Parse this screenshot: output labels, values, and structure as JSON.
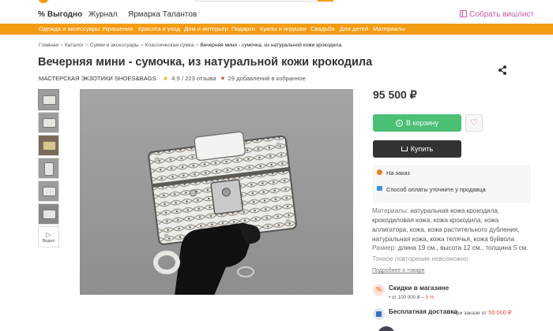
{
  "header": {
    "nav": [
      {
        "label": "Выгодно",
        "prefix": "%"
      },
      {
        "label": "Журнал"
      },
      {
        "label": "Ярмарка Талантов"
      }
    ],
    "wishlist_label": "Собрать вишлист"
  },
  "categories": [
    "Одежда и аксессуары",
    "Украшения",
    "Красота и уход",
    "Дом и интерьер",
    "Подарки",
    "Куклы и игрушки",
    "Свадьба",
    "Для детей",
    "Материалы"
  ],
  "breadcrumb": {
    "items": [
      "Главная",
      "Каталог",
      "Сумки и аксессуары",
      "Классическая сумка"
    ],
    "current": "Вечерняя мини - сумочка, из натуральной кожи крокодила."
  },
  "product": {
    "title": "Вечерняя мини - сумочка, из натуральной кожи крокодила",
    "shop": "МАСТЕРСКАЯ ЭКЗОТИКИ SHOES&BAGS",
    "rating": "4.9",
    "reviews": "/ 223 отзыва",
    "favorites": "29 добавлений в избранное",
    "price": "95 500 ₽",
    "video_label": "Видео"
  },
  "actions": {
    "cart_label": "В корзину",
    "buy_label": "Купить"
  },
  "info": {
    "order": "На заказ",
    "payment": "Способ оплаты уточните у продавца"
  },
  "properties": {
    "materials_label": "Материалы:",
    "materials_value": "натуральная кожа крокодила, крокодиловая кожа, кожа крокодила, кожа аллигатора, кожа, кожа растительного дубления, натуральная кожа, кожа телячья, кожа буйвола",
    "size_label": "Размер:",
    "size_value": "длина 19 см., высота 12 см., толщина 5 см.",
    "exact": "Точное повторение невозможно",
    "more_link": "Подробнее о товаре"
  },
  "promo": {
    "title": "Скидки в магазине",
    "condition": "от 100 000 ₽ –",
    "discount": "5 %"
  },
  "shipping": {
    "title": "Бесплатная доставка",
    "condition": "при заказе от",
    "amount": "50 000 ₽"
  },
  "colors": {
    "accent": "#f39c12",
    "cart": "#4bbf73",
    "buy": "#333333",
    "wishlist": "#c45aa6"
  }
}
